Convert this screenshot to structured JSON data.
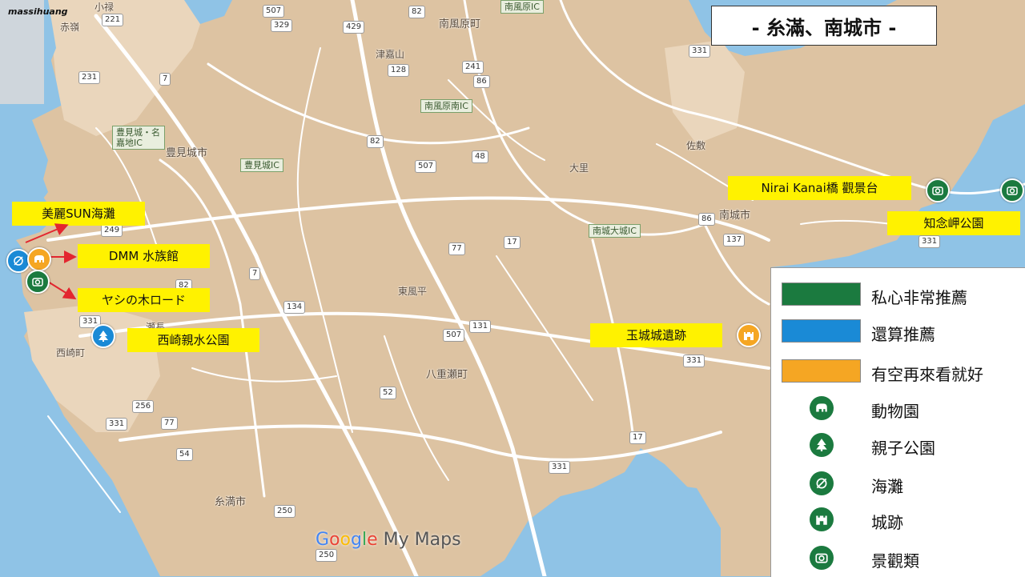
{
  "watermark": "massihuang",
  "title": "- 糸滿、南城市 -",
  "map_logo": {
    "google": [
      "G",
      "o",
      "o",
      "g",
      "l",
      "e"
    ],
    "suffix": "My Maps"
  },
  "places": {
    "tomigusuku": "豊見城市",
    "minami_kazehara": "南風原町",
    "tsukazan": "津嘉山",
    "ozato": "大里",
    "sashiki": "佐敷",
    "nanjo": "南城市",
    "kochinda": "東風平",
    "yaese": "八重瀬町",
    "nishizaki": "西崎町",
    "itoman": "糸満市",
    "akamine": "赤嶺",
    "oroku": "小禄",
    "senaga": "瀬長"
  },
  "ic_labels": {
    "haebaru_minami": "南風原南IC",
    "tomigusuku_nakachi": "豊見城・名嘉地IC",
    "tomigusuku_ic": "豊見城IC",
    "nanjo_ozato": "南城大城IC",
    "haebaru_kita": "南風原IC"
  },
  "shields": [
    "221",
    "507",
    "329",
    "82",
    "429",
    "7",
    "231",
    "128",
    "241",
    "86",
    "331",
    "82",
    "507",
    "48",
    "249",
    "77",
    "17",
    "86",
    "137",
    "7",
    "82",
    "134",
    "331",
    "131",
    "507",
    "256",
    "77",
    "331",
    "54",
    "52",
    "17",
    "331",
    "250",
    "250",
    "331",
    "331"
  ],
  "callouts": {
    "sun_beach": "美麗SUN海灘",
    "dmm": "DMM 水族館",
    "yashi": "ヤシの木ロード",
    "nishizaki_park": "西崎親水公園",
    "nirai": "Nirai Kanai橋 觀景台",
    "chinen": "知念岬公園",
    "tamagusuku": "玉城城遺跡"
  },
  "legend": {
    "items": [
      {
        "label": "私心非常推薦",
        "color": "#1b7a3f",
        "kind": "swatch"
      },
      {
        "label": "還算推薦",
        "color": "#1a8ad6",
        "kind": "swatch"
      },
      {
        "label": "有空再來看就好",
        "color": "#f5a623",
        "kind": "swatch"
      },
      {
        "label": "動物園",
        "icon": "elephant-icon",
        "kind": "icon"
      },
      {
        "label": "親子公園",
        "icon": "tree-icon",
        "kind": "icon"
      },
      {
        "label": "海灘",
        "icon": "beach-icon",
        "kind": "icon"
      },
      {
        "label": "城跡",
        "icon": "castle-icon",
        "kind": "icon"
      },
      {
        "label": "景觀類",
        "icon": "camera-icon",
        "kind": "icon"
      }
    ]
  },
  "colors": {
    "land": "#ddc3a2",
    "water": "#8fc3e6",
    "road": "#ffffff",
    "recommend_high": "#1b7a3f",
    "recommend_mid": "#1a8ad6",
    "recommend_low": "#f5a623",
    "callout": "#fff200"
  }
}
